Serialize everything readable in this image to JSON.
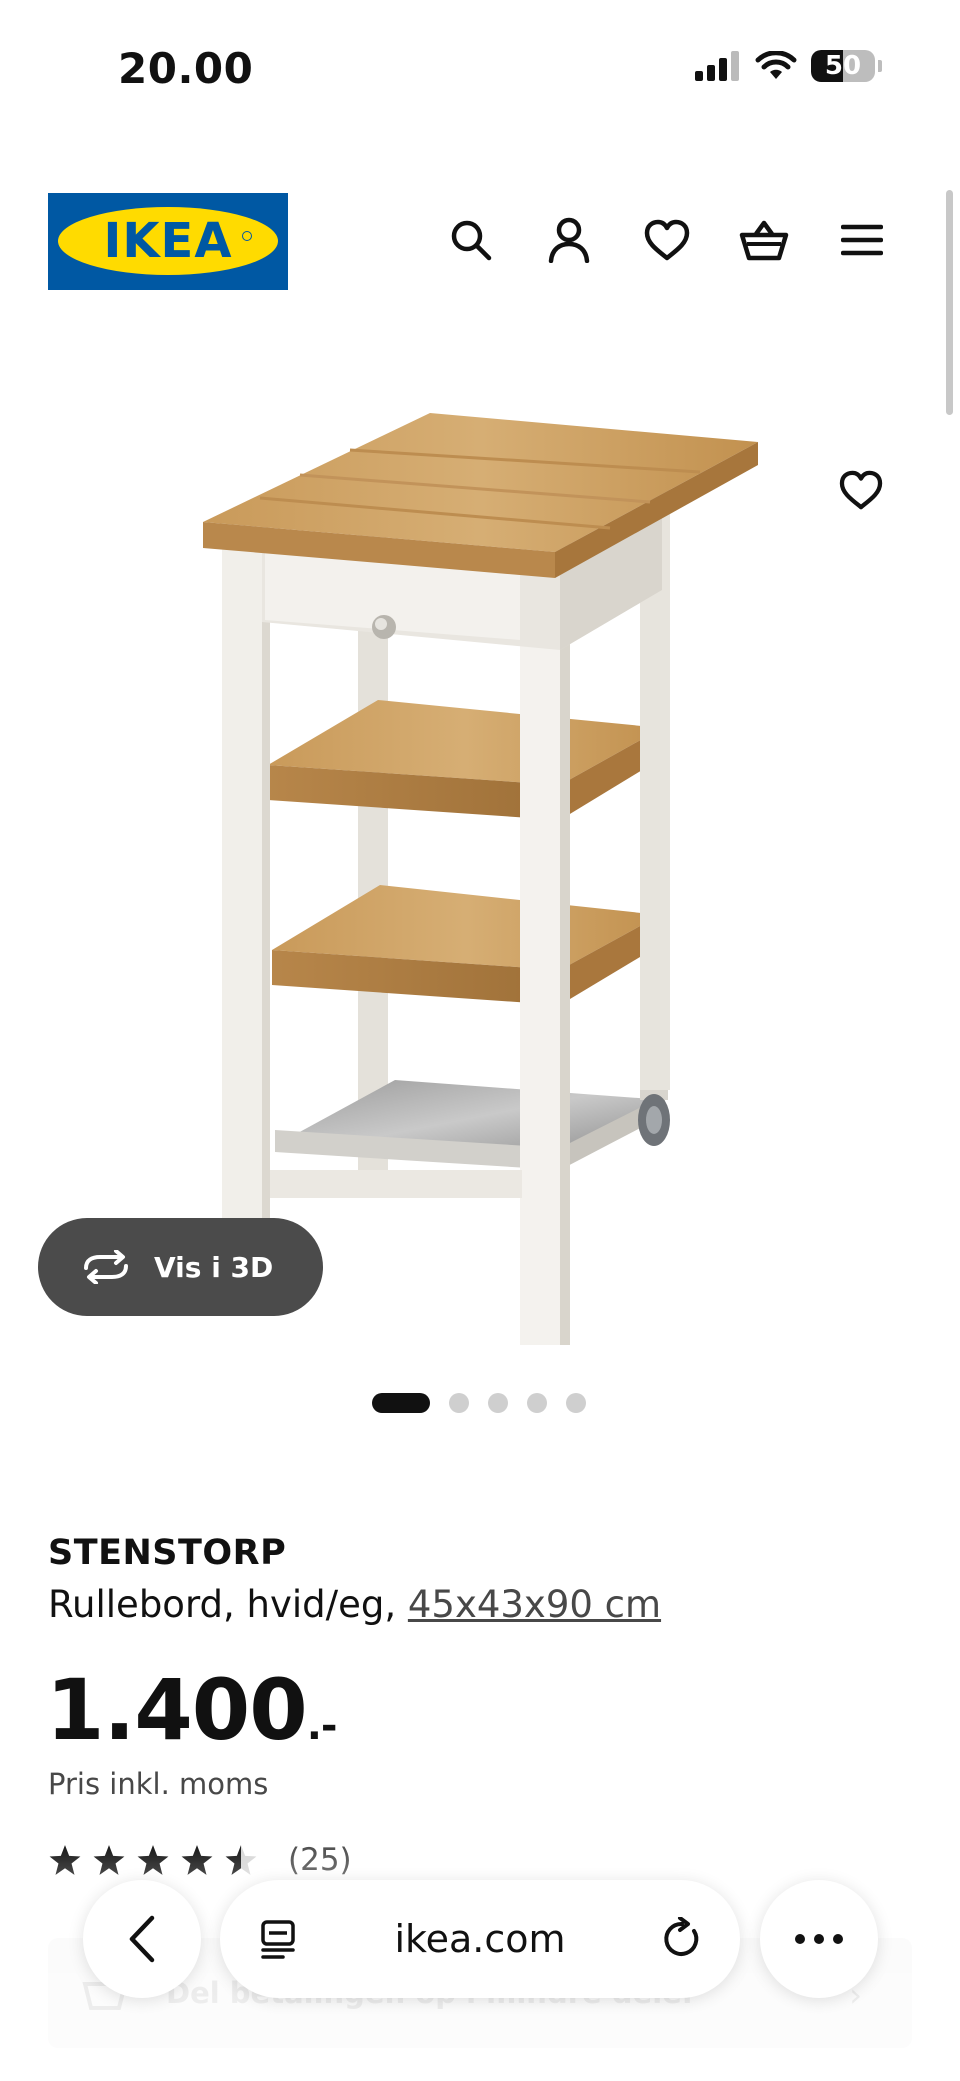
{
  "status_bar": {
    "time": "20.00",
    "battery_percent": "50",
    "battery_level": 0.5,
    "icons": [
      "signal-icon",
      "wifi-icon",
      "battery-icon"
    ]
  },
  "header": {
    "logo_text": "IKEA",
    "brand_colors": {
      "blue": "#0058a3",
      "yellow": "#ffdb00"
    },
    "icons": [
      "search-icon",
      "account-icon",
      "wishlist-heart-icon",
      "shopping-basket-icon",
      "menu-icon"
    ]
  },
  "product_image": {
    "view_3d_label": "Vis i 3D",
    "carousel": {
      "total": 5,
      "active": 1
    }
  },
  "product": {
    "name": "STENSTORP",
    "description_prefix": "Rullebord, hvid/eg,",
    "dimensions": "45x43x90 cm",
    "price_main": "1.400",
    "price_suffix": ".-",
    "price_note": "Pris inkl. moms",
    "rating_value": 4.5,
    "rating_max": 5,
    "review_count": "(25)"
  },
  "banner": {
    "text": "Del betalingen op i mindre dele.",
    "icon": "basket-split-icon"
  },
  "browser": {
    "address": "ikea.com",
    "icons": [
      "back-chevron-icon",
      "page-menu-icon",
      "reload-icon",
      "more-icon"
    ]
  }
}
